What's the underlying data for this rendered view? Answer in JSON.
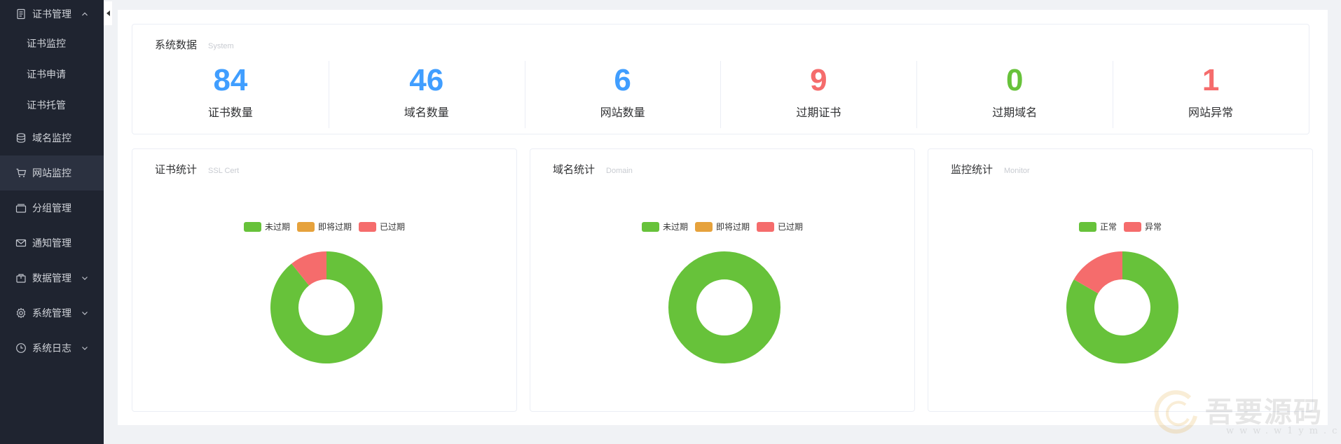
{
  "sidebar": {
    "items": [
      {
        "label": "证书管理",
        "icon": "document-icon",
        "expanded": true,
        "children": [
          "证书监控",
          "证书申请",
          "证书托管"
        ]
      },
      {
        "label": "域名监控",
        "icon": "database-icon"
      },
      {
        "label": "网站监控",
        "icon": "cart-icon",
        "active": true
      },
      {
        "label": "分组管理",
        "icon": "folder-icon"
      },
      {
        "label": "通知管理",
        "icon": "mail-icon"
      },
      {
        "label": "数据管理",
        "icon": "package-icon",
        "has_children": true
      },
      {
        "label": "系统管理",
        "icon": "gear-icon",
        "has_children": true
      },
      {
        "label": "系统日志",
        "icon": "clock-icon",
        "has_children": true
      }
    ]
  },
  "system": {
    "title": "系统数据",
    "subtitle": "System",
    "stats": [
      {
        "value": "84",
        "label": "证书数量",
        "color": "#409eff"
      },
      {
        "value": "46",
        "label": "域名数量",
        "color": "#409eff"
      },
      {
        "value": "6",
        "label": "网站数量",
        "color": "#409eff"
      },
      {
        "value": "9",
        "label": "过期证书",
        "color": "#f56c6c"
      },
      {
        "value": "0",
        "label": "过期域名",
        "color": "#67c23a"
      },
      {
        "value": "1",
        "label": "网站异常",
        "color": "#f56c6c"
      }
    ]
  },
  "charts": {
    "cert": {
      "title": "证书统计",
      "subtitle": "SSL Cert",
      "legend": [
        "未过期",
        "即将过期",
        "已过期"
      ]
    },
    "domain": {
      "title": "域名统计",
      "subtitle": "Domain",
      "legend": [
        "未过期",
        "即将过期",
        "已过期"
      ]
    },
    "monitor": {
      "title": "监控统计",
      "subtitle": "Monitor",
      "legend": [
        "正常",
        "异常"
      ]
    }
  },
  "colors": {
    "green": "#67c23a",
    "orange": "#e6a23c",
    "red": "#f56c6c",
    "blue": "#409eff"
  },
  "chart_data": [
    {
      "type": "pie",
      "title": "证书统计",
      "categories": [
        "未过期",
        "即将过期",
        "已过期"
      ],
      "values": [
        75,
        0,
        9
      ]
    },
    {
      "type": "pie",
      "title": "域名统计",
      "categories": [
        "未过期",
        "即将过期",
        "已过期"
      ],
      "values": [
        46,
        0,
        0
      ]
    },
    {
      "type": "pie",
      "title": "监控统计",
      "categories": [
        "正常",
        "异常"
      ],
      "values": [
        5,
        1
      ]
    }
  ],
  "watermark": {
    "text": "吾要源码",
    "url": "www.w1ym.com"
  }
}
